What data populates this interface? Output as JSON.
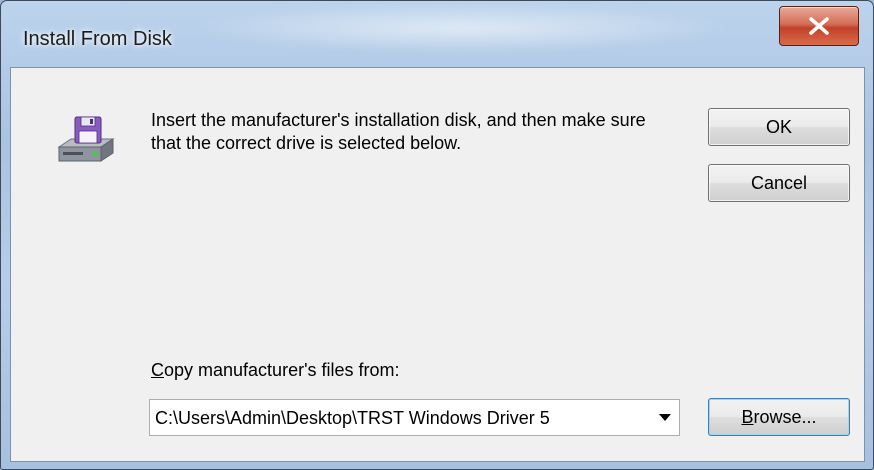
{
  "window": {
    "title": "Install From Disk",
    "close_glyph": "X"
  },
  "dialog": {
    "instructions": "Insert the manufacturer's installation disk, and then make sure that the correct drive is selected below.",
    "icon": "install-disk-icon",
    "ok_label": "OK",
    "cancel_label": "Cancel",
    "copy_label_accel": "C",
    "copy_label_rest": "opy manufacturer's files from:",
    "path_value": "C:\\Users\\Admin\\Desktop\\TRST Windows Driver 5",
    "browse_label_accel": "B",
    "browse_label_rest": "rowse..."
  },
  "colors": {
    "close_button": "#c2412a",
    "client_background": "#f0f0f0",
    "focus_border": "#3c7fb1"
  }
}
